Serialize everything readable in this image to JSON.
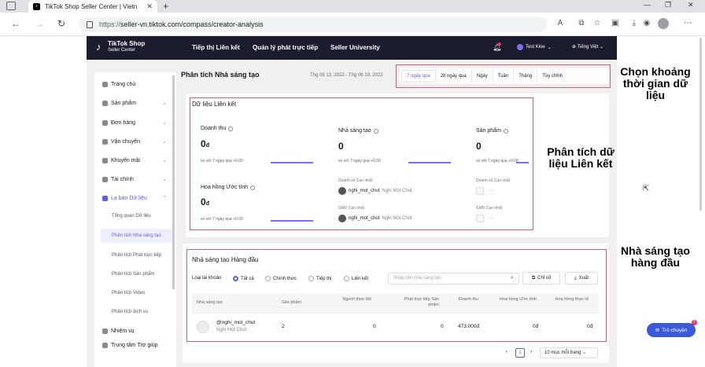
{
  "browser": {
    "tab_title": "TikTok Shop Seller Center | Vietn",
    "url_scheme": "https://",
    "url_rest": "seller-vn.tiktok.com/compass/creator-analysis"
  },
  "header": {
    "logo_main": "TikTok Shop",
    "logo_sub": "Seller Center",
    "nav": [
      "Tiếp thị Liên kết",
      "Quản lý phát trực tiếp",
      "Seller University"
    ],
    "user": "Test Kloe",
    "language": "Tiếng Việt"
  },
  "sidebar": {
    "items": [
      {
        "label": "Trang chủ"
      },
      {
        "label": "Sản phẩm"
      },
      {
        "label": "Đơn hàng"
      },
      {
        "label": "Vận chuyển"
      },
      {
        "label": "Khuyến mãi"
      },
      {
        "label": "Tài chính"
      },
      {
        "label": "La bàn Dữ liệu"
      }
    ],
    "subitems": [
      "Tổng quan Dữ liệu",
      "Phân tích Nhà sáng tạo",
      "Phân tích Phát trực tiếp",
      "Phân tích Sản phẩm",
      "Phân tích Video",
      "Phân tích dịch vụ"
    ],
    "bottom": [
      "Nhiệm vụ",
      "Trung tâm Trợ giúp"
    ]
  },
  "page": {
    "title": "Phân tích Nhà sáng tạo",
    "date_range": "Thg 06 13, 2022 - Thg 06 19, 2022",
    "date_tabs": [
      "7 ngày qua",
      "28 ngày qua",
      "Ngày",
      "Tuần",
      "Tháng",
      "Tùy chỉnh"
    ]
  },
  "affiliate": {
    "title": "Dữ liệu Liên kết",
    "revenue_label": "Doanh thu",
    "revenue_value": "0",
    "currency": "đ",
    "compare_text": "so với 7 ngày qua",
    "compare_delta": "+0.00",
    "commission_label": "Hoa hồng Ước tính",
    "commission_value": "0",
    "creators_label": "Nhà sáng tạo",
    "creators_value": "0",
    "top_sales_label": "Doanh số Cao nhất",
    "top_gmv_label": "GMV Cao nhất",
    "top_creator_handle": "nghi_mot_chut",
    "top_creator_name": "Nghi Một Chút",
    "products_label": "Sản phẩm",
    "products_value": "0",
    "dash": "- -"
  },
  "top_creators": {
    "title": "Nhà sáng tạo Hàng đầu",
    "filter_label": "Loại tài khoản",
    "filters": [
      "Tất cả",
      "Chính thức",
      "Tiếp thị",
      "Liên kết"
    ],
    "search_placeholder": "Nhập tên nhà sáng tạo",
    "metrics_button": "Chỉ số",
    "export_button": "Xuất",
    "columns": [
      "Nhà sáng tạo",
      "Sản phẩm",
      "Người theo dõi",
      "Phát trực tiếp Sản phẩm",
      "Doanh thu",
      "Hoa hồng Ước tính",
      "Hoa hồng thực tế"
    ],
    "rows": [
      {
        "handle": "@nghi_mot_chut",
        "name": "Nghi Một Chút",
        "products": "2",
        "followers": "0",
        "live": "0",
        "revenue": "473.000đ",
        "commission_est": "0đ",
        "commission_actual": "0đ"
      }
    ],
    "page_number": "1",
    "page_size": "10 mục mỗi trang"
  },
  "annotations": {
    "date_note": "Chọn khoảng thời gian dữ liệu",
    "affiliate_note": "Phân tích dữ liệu Liên kết",
    "creators_note": "Nhà sáng tạo hàng đầu"
  },
  "chat": {
    "label": "Trò chuyện",
    "badge": "1"
  }
}
